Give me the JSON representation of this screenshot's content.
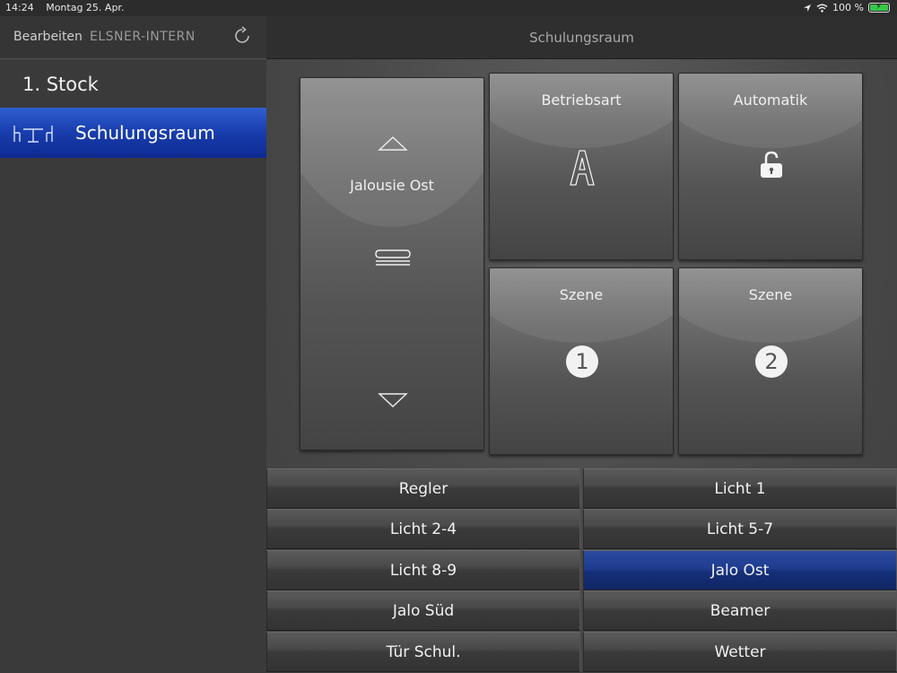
{
  "status_bar": {
    "time": "14:24",
    "date": "Montag 25. Apr.",
    "battery": "100 %"
  },
  "nav": {
    "edit_label": "Bearbeiten",
    "group_label": "ELSNER-INTERN",
    "title": "Schulungsraum"
  },
  "sidebar": {
    "floor": "1. Stock",
    "items": [
      {
        "label": "Schulungsraum",
        "icon": "room-table-icon",
        "selected": true
      }
    ]
  },
  "tiles": {
    "blind": {
      "label": "Jalousie Ost"
    },
    "mode": {
      "label": "Betriebsart",
      "symbol": "A"
    },
    "automatic": {
      "label": "Automatik"
    },
    "scene1": {
      "label": "Szene",
      "number": "1"
    },
    "scene2": {
      "label": "Szene",
      "number": "2"
    }
  },
  "buttons": [
    {
      "label": "Regler",
      "active": false
    },
    {
      "label": "Licht 1",
      "active": false
    },
    {
      "label": "Licht 2-4",
      "active": false
    },
    {
      "label": "Licht 5-7",
      "active": false
    },
    {
      "label": "Licht 8-9",
      "active": false
    },
    {
      "label": "Jalo Ost",
      "active": true
    },
    {
      "label": "Jalo Süd",
      "active": false
    },
    {
      "label": "Beamer",
      "active": false
    },
    {
      "label": "Tür Schul.",
      "active": false
    },
    {
      "label": "Wetter",
      "active": false
    }
  ],
  "colors": {
    "selected_blue": "#1a3fb0",
    "battery_green": "#37c84a"
  }
}
